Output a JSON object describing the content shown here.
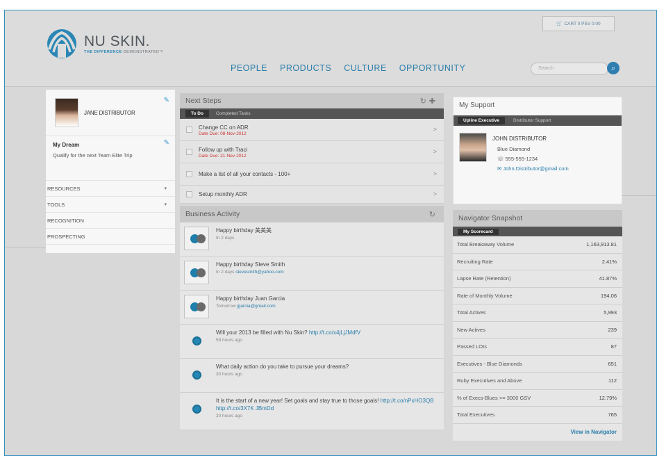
{
  "brand": {
    "name": "NU SKIN.",
    "tagline_bold": "THE DIFFERENCE",
    "tagline_rest": " DEMONSTRATED™",
    "color": "#2a87b5"
  },
  "cart": {
    "label": "CART 0 PSV 0.00",
    "icon": "cart-icon"
  },
  "nav": [
    "PEOPLE",
    "PRODUCTS",
    "CULTURE",
    "OPPORTUNITY"
  ],
  "search": {
    "placeholder": "Search",
    "icon": "search-icon"
  },
  "profile": {
    "name": "JANE DISTRIBUTOR"
  },
  "dream": {
    "title": "My Dream",
    "text": "Qualify for the next Team Elite Trip"
  },
  "sidebar": [
    "RESOURCES",
    "TOOLS",
    "RECOGNITION",
    "PROSPECTING"
  ],
  "next_steps": {
    "title": "Next Steps",
    "tabs": [
      "To Do",
      "Completed Tasks"
    ],
    "tasks": [
      {
        "text": "Change CC on ADR",
        "due": "Date Due: 08-Nov-2012"
      },
      {
        "text": "Follow up with Traci",
        "due": "Date Due: 21-Nov-2012"
      },
      {
        "text": "Make a list of all your contacts - 100+",
        "due": ""
      },
      {
        "text": "Setup monthly ADR",
        "due": ""
      }
    ]
  },
  "business": {
    "title": "Business Activity",
    "items": [
      {
        "text": "Happy birthday 美美美",
        "time": "In 2 days",
        "link": ""
      },
      {
        "text": "Happy birthday Steve Smith",
        "time": "In 2 days",
        "link": "stevesmith@yahoo.com"
      },
      {
        "text": "Happy birthday Juan Garcia",
        "time": "Tomorrow",
        "link": "jgarcia@gmail.com"
      },
      {
        "text": "Will your 2013 be filled with Nu Skin? ",
        "time": "58 hours ago",
        "link": "http://t.co/x4jLjJMdfV"
      },
      {
        "text": "What daily action do you take to pursue your dreams?",
        "time": "30 hours ago",
        "link": ""
      },
      {
        "text": "It is the start of a new year! Set goals and stay true to those goals! ",
        "time": "20 hours ago",
        "link": "http://t.co/nPxHO3QB http://t.co/3X7K JBmDd"
      }
    ]
  },
  "support": {
    "title": "My Support",
    "tabs": [
      "Upline Executive",
      "Distributor Support"
    ],
    "name": "JOHN DISTRIBUTOR",
    "rank": "Blue Diamond",
    "phone": "555-555-1234",
    "email": "John.Distributor@gmail.com"
  },
  "snapshot": {
    "title": "Navigator Snapshot",
    "tab": "My Scorecard",
    "rows": [
      {
        "label": "Total Breakaway Volume",
        "value": "1,163,913.81"
      },
      {
        "label": "Recruiting Rate",
        "value": "2.41%"
      },
      {
        "label": "Lapse Rate (Retention)",
        "value": "41.87%"
      },
      {
        "label": "Rate of Monthly Volume",
        "value": "194.06"
      },
      {
        "label": "Total Actives",
        "value": "5,993"
      },
      {
        "label": "New Actives",
        "value": "239"
      },
      {
        "label": "Passed LOIs",
        "value": "87"
      },
      {
        "label": "Executives - Blue Diamonds",
        "value": "651"
      },
      {
        "label": "Ruby Executives and Above",
        "value": "112"
      },
      {
        "label": "% of Execs-Blues >= 3000 GSV",
        "value": "12.79%"
      },
      {
        "label": "Total Executives",
        "value": "765"
      }
    ],
    "view_link": "View in Navigator"
  }
}
